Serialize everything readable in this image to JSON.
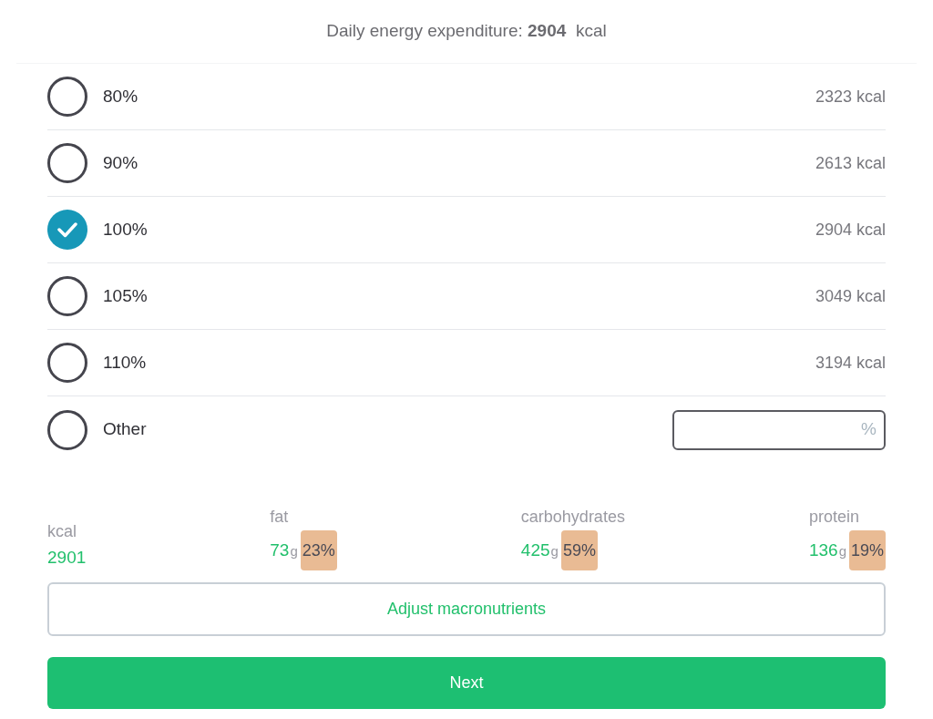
{
  "header": {
    "text": "Daily energy expenditure: **2904**  kcal"
  },
  "options": [
    {
      "kind": "preset",
      "label": "80%",
      "value": "2323 kcal",
      "selected": false
    },
    {
      "kind": "preset",
      "label": "90%",
      "value": "2613 kcal",
      "selected": false
    },
    {
      "kind": "preset",
      "label": "100%",
      "value": "2904 kcal",
      "selected": true
    },
    {
      "kind": "preset",
      "label": "105%",
      "value": "3049 kcal",
      "selected": false
    },
    {
      "kind": "preset",
      "label": "110%",
      "value": "3194 kcal",
      "selected": false
    },
    {
      "kind": "custom",
      "label": "Other",
      "suffix": "%",
      "selected": false
    }
  ],
  "macros": [
    {
      "kind": "total",
      "label": "kcal",
      "amount": "2901"
    },
    {
      "kind": "nutrient",
      "label": "fat",
      "amount": "73",
      "unit": "g",
      "share": "23%"
    },
    {
      "kind": "nutrient",
      "label": "carbohydrates",
      "amount": "425",
      "unit": "g",
      "share": "59%"
    },
    {
      "kind": "nutrient",
      "label": "protein",
      "amount": "136",
      "unit": "g",
      "share": "19%"
    }
  ],
  "adjust_button": "Adjust macronutrients",
  "next_button": "Next"
}
